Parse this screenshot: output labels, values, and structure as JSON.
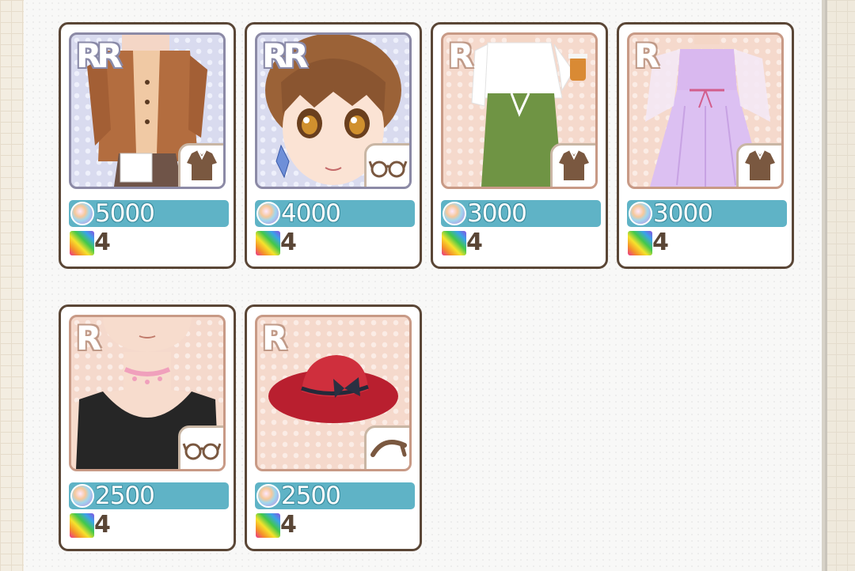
{
  "items": [
    {
      "rarity": "RR",
      "category": "tops-icon",
      "price": "5000",
      "qty": "4"
    },
    {
      "rarity": "RR",
      "category": "accessory-icon",
      "price": "4000",
      "qty": "4"
    },
    {
      "rarity": "R",
      "category": "tops-icon",
      "price": "3000",
      "qty": "4"
    },
    {
      "rarity": "R",
      "category": "tops-icon",
      "price": "3000",
      "qty": "4"
    },
    {
      "rarity": "R",
      "category": "accessory-icon",
      "price": "2500",
      "qty": "4"
    },
    {
      "rarity": "R",
      "category": "hat-icon",
      "price": "2500",
      "qty": "4"
    }
  ],
  "colors": {
    "card_border": "#5a4636",
    "price_bar": "#5fb3c6",
    "rr_frame": "#d9dbef",
    "r_frame": "#f5d9cc"
  }
}
